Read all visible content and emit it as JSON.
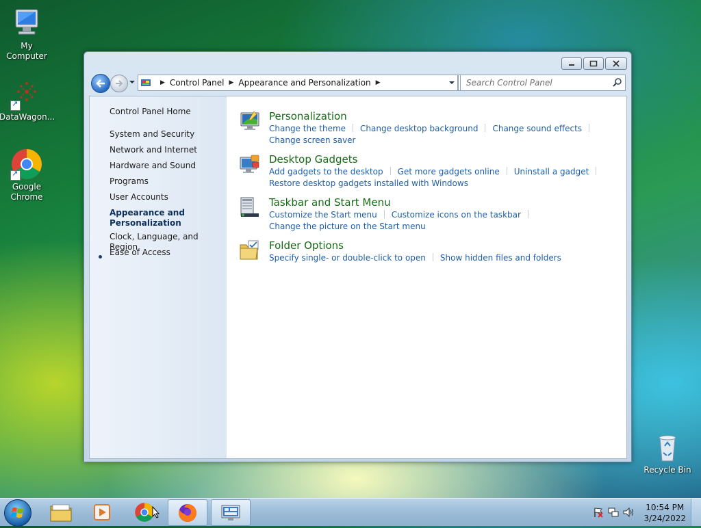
{
  "desktop": {
    "icons": [
      {
        "label": "My Computer"
      },
      {
        "label": "DataWagon..."
      },
      {
        "label": "Google Chrome"
      },
      {
        "label": "Recycle Bin"
      }
    ]
  },
  "window": {
    "controls": {
      "minimize": "minimize",
      "maximize": "maximize",
      "close": "close"
    },
    "breadcrumb": [
      "Control Panel",
      "Appearance and Personalization"
    ],
    "search_placeholder": "Search Control Panel"
  },
  "sidebar": {
    "home": "Control Panel Home",
    "items": [
      {
        "label": "System and Security"
      },
      {
        "label": "Network and Internet"
      },
      {
        "label": "Hardware and Sound"
      },
      {
        "label": "Programs"
      },
      {
        "label": "User Accounts"
      },
      {
        "label": "Appearance and\nPersonalization",
        "line1": "Appearance and",
        "line2": "Personalization",
        "active": true
      },
      {
        "label": "Clock, Language, and Region"
      },
      {
        "label": "Ease of Access"
      }
    ]
  },
  "categories": [
    {
      "title": "Personalization",
      "icon": "personalization-icon",
      "links": [
        "Change the theme",
        "Change desktop background",
        "Change sound effects",
        "Change screen saver"
      ]
    },
    {
      "title": "Desktop Gadgets",
      "icon": "gadgets-icon",
      "links": [
        "Add gadgets to the desktop",
        "Get more gadgets online",
        "Uninstall a gadget",
        "Restore desktop gadgets installed with Windows"
      ]
    },
    {
      "title": "Taskbar and Start Menu",
      "icon": "taskbar-icon",
      "links": [
        "Customize the Start menu",
        "Customize icons on the taskbar",
        "Change the picture on the Start menu"
      ]
    },
    {
      "title": "Folder Options",
      "icon": "folder-options-icon",
      "links": [
        "Specify single- or double-click to open",
        "Show hidden files and folders"
      ]
    }
  ],
  "taskbar": {
    "buttons": [
      "start-orb",
      "file-explorer",
      "media-player",
      "google-chrome",
      "firefox",
      "control-panel"
    ],
    "clock": {
      "time": "10:54 PM",
      "date": "3/24/2022"
    }
  }
}
